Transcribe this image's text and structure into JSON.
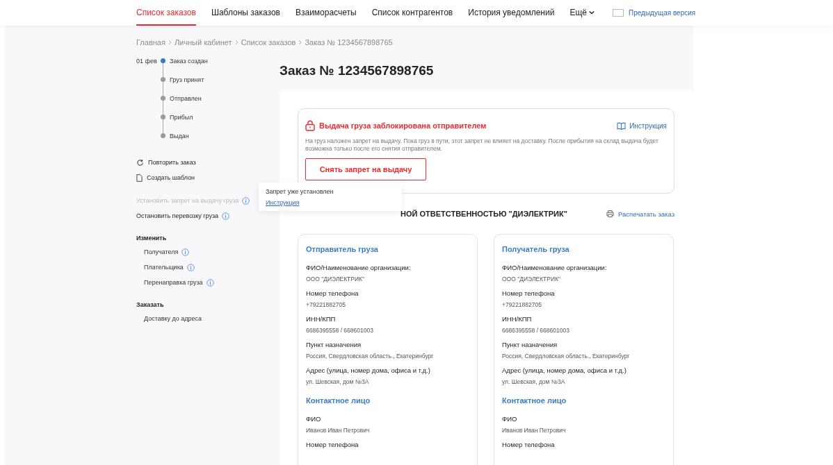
{
  "nav": {
    "items": [
      {
        "label": "Список заказов",
        "selected": true
      },
      {
        "label": "Шаблоны заказов",
        "selected": false
      },
      {
        "label": "Взаиморасчеты",
        "selected": false
      },
      {
        "label": "Список контрагентов",
        "selected": false
      },
      {
        "label": "История уведомлений",
        "selected": false
      },
      {
        "label": "Ещё",
        "selected": false
      }
    ],
    "prev_version": "Предыдущая версия"
  },
  "breadcrumbs": [
    "Главная",
    "Личный кабинет",
    "Список заказов",
    "Заказ № 1234567898765"
  ],
  "timeline": {
    "date": "01 фев",
    "steps": [
      {
        "label": "Заказ создан",
        "done": true
      },
      {
        "label": "Груз принят",
        "done": false
      },
      {
        "label": "Отправлен",
        "done": false
      },
      {
        "label": "Прибыл",
        "done": false
      },
      {
        "label": "Выдан",
        "done": false
      }
    ]
  },
  "actions": [
    {
      "kind": "repeat",
      "label": "Повторить заказ"
    },
    {
      "kind": "template",
      "label": "Создать шаблон"
    }
  ],
  "stop_actions": [
    {
      "label": "Установить запрет на выдачу груза",
      "disabled": true
    },
    {
      "label": "Остановить перевозку груза",
      "disabled": false
    }
  ],
  "groups": [
    {
      "title": "Изменить",
      "items": [
        {
          "label": "Получателя",
          "info": true
        },
        {
          "label": "Плательщика",
          "info": true
        },
        {
          "label": "Перенаправка груза",
          "info": true
        }
      ]
    },
    {
      "title": "Заказать",
      "items": [
        {
          "label": "Доставку до адреса",
          "info": false
        }
      ]
    }
  ],
  "popover": {
    "text": "Запрет уже установлен",
    "link": "Инструкция"
  },
  "title": "Заказ № 1234567898765",
  "alert": {
    "title": "Выдача груза заблокирована отправителем",
    "instruction": "Инструкция",
    "text": "На груз наложен запрет на выдачу. Пока груз в пути, этот запрет не влияет на доставку. После прибытия на склад выдача будет возможна только после его снятия отправителем.",
    "button": "Снять запрет на выдачу"
  },
  "company_heading": "НОЙ ОТВЕТСТВЕННОСТЬЮ \"ДИЭЛЕКТРИК\"",
  "print_label": "Распечатать заказ",
  "parties": [
    {
      "title": "Отправитель груза",
      "fields": [
        {
          "label": "ФИО/Наименование организации:",
          "value": "ООО \"ДИЭЛЕКТРИК\""
        },
        {
          "label": "Номер телефона",
          "value": "+79221882705"
        },
        {
          "label": "ИНН/КПП",
          "value": "6686395558 / 668601003"
        },
        {
          "label": "Пункт назначения",
          "value": "Россия, Свердловская область., Екатеринбург"
        },
        {
          "label": "Адрес (улица, номер дома, офиса и т.д.)",
          "value": "ул. Шевская, дом №3А"
        }
      ],
      "contact_title": "Контактное лицо",
      "contact_fields": [
        {
          "label": "ФИО",
          "value": "Иванов Иван Петрович"
        },
        {
          "label": "Номер телефона"
        }
      ]
    },
    {
      "title": "Получатель груза",
      "fields": [
        {
          "label": "ФИО/Наименование организации:",
          "value": "ООО \"ДИЭЛЕКТРИК\""
        },
        {
          "label": "Номер телефона",
          "value": "+79221882705"
        },
        {
          "label": "ИНН/КПП",
          "value": "6686395558 / 668601003"
        },
        {
          "label": "Пункт назначения",
          "value": "Россия, Свердловская область., Екатеринбург"
        },
        {
          "label": "Адрес (улица, номер дома, офиса и т.д.)",
          "value": "ул. Шевская, дом №3А"
        }
      ],
      "contact_title": "Контактное лицо",
      "contact_fields": [
        {
          "label": "ФИО",
          "value": "Иванов Иван Петрович"
        },
        {
          "label": "Номер телефона"
        }
      ]
    }
  ]
}
